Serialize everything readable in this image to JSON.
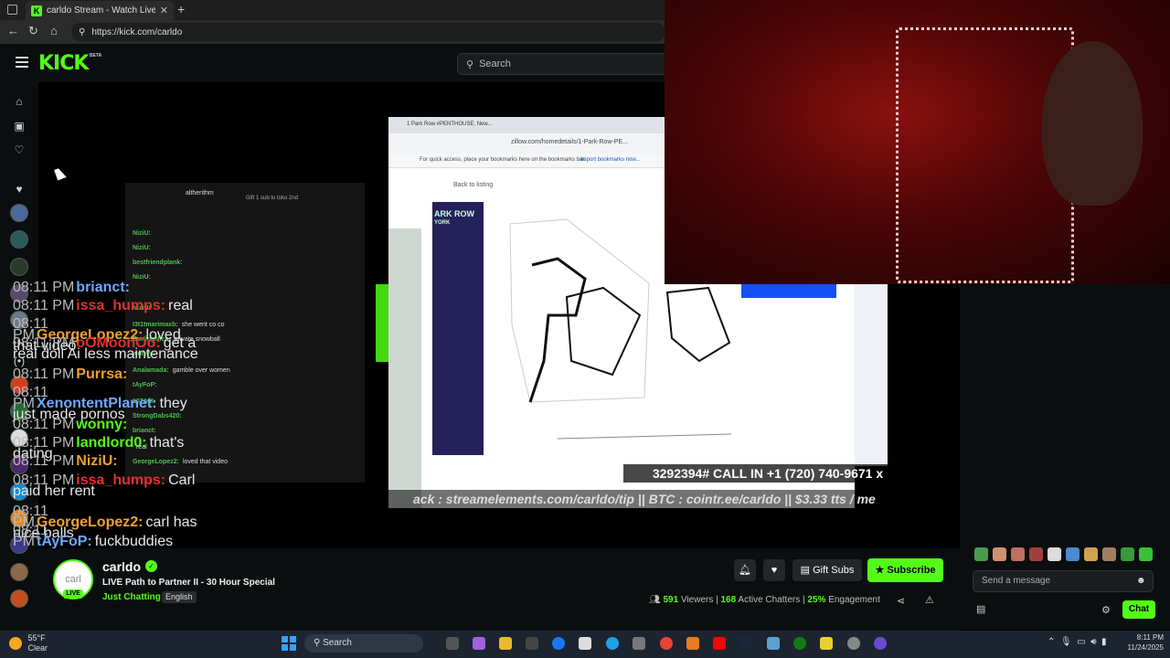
{
  "browser": {
    "tab_title": "carldo Stream - Watch Live on Ki",
    "url": "https://kick.com/carldo",
    "new_tab": "+"
  },
  "kick": {
    "logo": "KICK",
    "beta": "BETA",
    "search_placeholder": "Search"
  },
  "sidebar": {
    "icons": [
      "home-icon",
      "browse-icon",
      "following-icon",
      "heart-icon",
      "live-icon"
    ]
  },
  "stream_overlay": {
    "sub_user": "altherithm",
    "sub_text": "Gift 1 sub to toko 2nd",
    "chat_lines": [
      {
        "user": "NiziU:",
        "text": ""
      },
      {
        "user": "NiziU:",
        "text": ""
      },
      {
        "user": "bestfriendplank:",
        "text": ""
      },
      {
        "user": "NiziU:",
        "text": ""
      },
      {
        "user": "",
        "text": ""
      },
      {
        "user": "NiziU:",
        "text": ""
      },
      {
        "user": "I3t1tmarimaxb:",
        "text": "she went co co"
      },
      {
        "user": "CurlingNick:",
        "text": "private snowball"
      },
      {
        "user": "wonny:",
        "text": ""
      },
      {
        "user": "Analamada:",
        "text": "gamble over women"
      },
      {
        "user": "tAyFoP:",
        "text": ""
      },
      {
        "user": "107AM:",
        "text": ""
      },
      {
        "user": "StrongDabs420:",
        "text": ""
      },
      {
        "user": "brianct:",
        "text": ""
      },
      {
        "user": "",
        "text": "real"
      },
      {
        "user": "GeorgeLopez2:",
        "text": "loved that video"
      }
    ],
    "listing_url": "zillow.com/homedetails/1-Park-Row-PE...",
    "listing_tab": "1 Park Row #PENTHOUSE, New...",
    "bookmarks_text": "For quick access, place your bookmarks here on the bookmarks bar.",
    "bookmarks_link": "Import bookmarks now...",
    "back_link": "Back to listing",
    "building_name": "ARK ROW",
    "building_sub": "YORK",
    "call_in": "3292394#   CALL IN +1 (720) 740-9671 x",
    "ticker": "ack : streamelements.com/carldo/tip || BTC : cointr.ee/carldo || $3.33 tts / me"
  },
  "chat": {
    "messages": [
      {
        "time": "08:11 PM",
        "user": "brianct:",
        "color": "u-blue",
        "text": ""
      },
      {
        "time": "08:11 PM",
        "user": "issa_humps:",
        "color": "u-red",
        "text": "real"
      },
      {
        "time": "08:11 PM",
        "user": "GeorgeLopez2:",
        "color": "u-orange",
        "text": "loved that video"
      },
      {
        "time": "08:11 PM",
        "user": "oOMoonOo:",
        "color": "u-red",
        "text": "get a real doll Ai less maintenance"
      },
      {
        "time": "08:11 PM",
        "user": "Purrsa:",
        "color": "u-orange",
        "text": ""
      },
      {
        "time": "08:11 PM",
        "user": "XenontentPlanet:",
        "color": "u-blue",
        "text": "they just made pornos"
      },
      {
        "time": "08:11 PM",
        "user": "wonny:",
        "color": "u-green",
        "text": ""
      },
      {
        "time": "08:11 PM",
        "user": "landlord0:",
        "color": "u-green",
        "text": "that's dating"
      },
      {
        "time": "08:11 PM",
        "user": "NiziU:",
        "color": "u-orange",
        "text": ""
      },
      {
        "time": "08:11 PM",
        "user": "issa_humps:",
        "color": "u-red",
        "text": "Carl paid her rent"
      },
      {
        "time": "08:11 PM",
        "user": "GeorgeLopez2:",
        "color": "u-orange",
        "text": "carl has nice balls"
      },
      {
        "time": "08:11 PM",
        "user": "tAyFoP:",
        "color": "u-blue",
        "text": "fuckbuddies"
      }
    ],
    "input_placeholder": "Send a message",
    "chat_button": "Chat"
  },
  "channel": {
    "avatar_text": "carl",
    "live_badge": "LIVE",
    "name": "carldo",
    "title": "LIVE Path to Partner II - 30 Hour Special",
    "category": "Just Chatting",
    "language": "English",
    "gift_subs": "Gift Subs",
    "subscribe": "Subscribe",
    "viewers_count": "591",
    "viewers_label": "Viewers",
    "chatters_count": "168",
    "chatters_label": "Active Chatters",
    "engagement_pct": "25%",
    "engagement_label": "Engagement"
  },
  "taskbar": {
    "temp": "55°F",
    "weather": "Clear",
    "search": "Search",
    "time": "8:11 PM",
    "date": "11/24/2025"
  },
  "colors": {
    "kick_green": "#53fc18",
    "bg": "#0b0e0f"
  }
}
